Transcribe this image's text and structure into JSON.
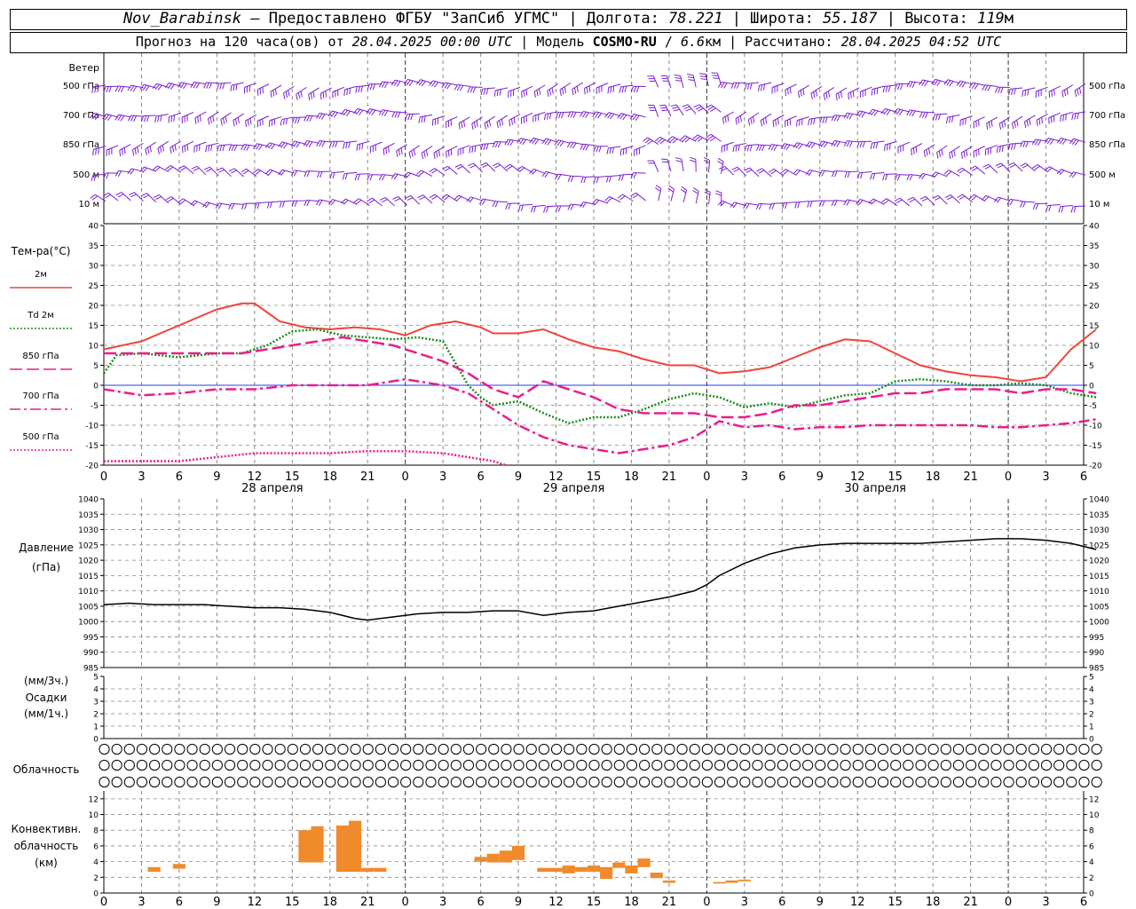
{
  "header": {
    "station": "Nov_Barabinsk",
    "provider": " — Предоставлено ФГБУ \"ЗапСиб УГМС\" | Долгота: ",
    "lon": "78.221",
    "lat_label": " | Широта: ",
    "lat": "55.187",
    "alt_label": " | Высота: ",
    "alt": "119",
    "alt_unit": "м",
    "forecast_label": "Прогноз на 120 часа(ов) от ",
    "forecast_from": "28.04.2025 00:00 UTC",
    "model_label": " | Модель ",
    "model": "COSMO-RU",
    "model_sep": " / ",
    "model_res": "6.6",
    "model_unit": "км",
    "calc_label": " | Рассчитано: ",
    "calc_time": "28.04.2025 04:52 UTC"
  },
  "time_axis": {
    "hour_labels": [
      "0",
      "3",
      "6",
      "9",
      "12",
      "15",
      "18",
      "21",
      "0",
      "3",
      "6",
      "9",
      "12",
      "15",
      "18",
      "21",
      "0",
      "3",
      "6",
      "9",
      "12",
      "15",
      "18",
      "21",
      "0",
      "3",
      "6"
    ],
    "day_labels": [
      {
        "label": "28 апреля",
        "hour": 12
      },
      {
        "label": "29 апреля",
        "hour": 36
      },
      {
        "label": "30 апреля",
        "hour": 60
      }
    ]
  },
  "wind_panel": {
    "title": "Ветер",
    "levels": [
      "500 гПа",
      "700 гПа",
      "850 гПа",
      "500  м",
      "10   м"
    ],
    "color": "#7a1fd1"
  },
  "chart_data": [
    {
      "type": "line",
      "name": "temperature",
      "title": "Тем-ра(°C)",
      "ylim": [
        -20,
        40
      ],
      "yticks": [
        -20,
        -15,
        -10,
        -5,
        0,
        5,
        10,
        15,
        20,
        25,
        30,
        35,
        40
      ],
      "grid": true,
      "legend_placement": "left",
      "series": [
        {
          "name": "2м",
          "color": "#f0443a",
          "style": "solid",
          "x": [
            0,
            3,
            6,
            9,
            11,
            12,
            14,
            16,
            18,
            20,
            22,
            24,
            26,
            28,
            30,
            31,
            33,
            35,
            37,
            39,
            41,
            43,
            45,
            47,
            49,
            51,
            53,
            55,
            57,
            59,
            61,
            63,
            65,
            67,
            69,
            71,
            73,
            75,
            77,
            79
          ],
          "y": [
            9,
            11,
            15,
            19,
            20.5,
            20.5,
            16,
            14.5,
            14,
            14.5,
            14,
            12.5,
            15,
            16,
            14.5,
            13,
            13,
            14,
            11.5,
            9.5,
            8.5,
            6.5,
            5,
            5,
            3,
            3.5,
            4.5,
            7,
            9.5,
            11.5,
            11,
            8,
            5,
            3.5,
            2.5,
            2,
            1,
            2,
            9,
            14
          ]
        },
        {
          "name": "Td 2м",
          "color": "#1e8a1e",
          "style": "dotted",
          "x": [
            0,
            1,
            3,
            6,
            9,
            11,
            13,
            15,
            17,
            19,
            21,
            23,
            25,
            27,
            29,
            30,
            31,
            33,
            35,
            37,
            39,
            41,
            43,
            45,
            47,
            49,
            51,
            53,
            55,
            57,
            59,
            61,
            63,
            65,
            67,
            69,
            71,
            73,
            75,
            77,
            79
          ],
          "y": [
            3,
            7.5,
            8,
            7,
            8,
            8,
            10,
            13.5,
            14,
            12.5,
            12,
            11.5,
            12,
            11,
            0,
            -3,
            -5,
            -4,
            -7,
            -9.5,
            -8,
            -8,
            -6,
            -3.5,
            -2,
            -3,
            -5.5,
            -4.5,
            -5.5,
            -4,
            -2.5,
            -2,
            1,
            1.5,
            1,
            0,
            0,
            0.5,
            0,
            -2,
            -3
          ]
        },
        {
          "name": "850 гПа",
          "color": "#e81e8c",
          "style": "dash",
          "x": [
            0,
            3,
            6,
            9,
            11,
            13,
            15,
            17,
            19,
            21,
            23,
            25,
            27,
            29,
            31,
            33,
            35,
            37,
            39,
            41,
            43,
            45,
            47,
            49,
            51,
            53,
            55,
            57,
            59,
            61,
            63,
            65,
            67,
            69,
            71,
            73,
            75,
            77,
            79
          ],
          "y": [
            8,
            8,
            8,
            8,
            8,
            9,
            10,
            11,
            12,
            11,
            10,
            8,
            6,
            3,
            -1,
            -3,
            1,
            -1,
            -3,
            -6,
            -7,
            -7,
            -7,
            -8,
            -8,
            -7,
            -5,
            -5,
            -4,
            -3,
            -2,
            -2,
            -1,
            -1,
            -1,
            -2,
            -1,
            -1,
            -2
          ]
        },
        {
          "name": "700 гПа",
          "color": "#e81e8c",
          "style": "dashdot",
          "x": [
            0,
            3,
            6,
            9,
            12,
            15,
            18,
            21,
            24,
            27,
            29,
            31,
            33,
            35,
            37,
            39,
            41,
            43,
            45,
            47,
            49,
            51,
            53,
            55,
            57,
            59,
            61,
            63,
            65,
            67,
            69,
            71,
            73,
            75,
            77,
            79
          ],
          "y": [
            -1,
            -2.5,
            -2,
            -1,
            -1,
            0,
            0,
            0,
            1.5,
            0,
            -2,
            -6,
            -10,
            -13,
            -15,
            -16,
            -17,
            -16,
            -15,
            -13,
            -9,
            -10.5,
            -10,
            -11,
            -10.5,
            -10.5,
            -10,
            -10,
            -10,
            -10,
            -10,
            -10.5,
            -10.5,
            -10,
            -9.5,
            -8.5
          ]
        },
        {
          "name": "500 гПа",
          "color": "#e81e8c",
          "style": "dotted",
          "x": [
            0,
            3,
            6,
            9,
            12,
            15,
            18,
            21,
            24,
            27,
            29,
            31,
            32
          ],
          "y": [
            -19,
            -19,
            -19,
            -18,
            -17,
            -17,
            -17,
            -16.5,
            -16.5,
            -17,
            -18,
            -19,
            -20
          ]
        }
      ]
    },
    {
      "type": "line",
      "name": "pressure",
      "title": "Давление",
      "ylabel": "(гПа)",
      "ylim": [
        985,
        1040
      ],
      "yticks": [
        985,
        990,
        995,
        1000,
        1005,
        1010,
        1015,
        1020,
        1025,
        1030,
        1035,
        1040
      ],
      "grid": true,
      "series": [
        {
          "color": "#000000",
          "x": [
            0,
            2,
            4,
            6,
            8,
            10,
            12,
            14,
            16,
            18,
            20,
            21,
            23,
            25,
            27,
            29,
            31,
            33,
            35,
            37,
            39,
            41,
            43,
            45,
            47,
            48,
            49,
            51,
            53,
            55,
            57,
            59,
            61,
            63,
            65,
            67,
            69,
            71,
            73,
            75,
            77,
            79
          ],
          "y": [
            1005.5,
            1006,
            1005.5,
            1005.5,
            1005.5,
            1005,
            1004.5,
            1004.5,
            1004,
            1003,
            1001,
            1000.5,
            1001.5,
            1002.5,
            1003,
            1003,
            1003.5,
            1003.5,
            1002,
            1003,
            1003.5,
            1005,
            1006.5,
            1008,
            1010,
            1012,
            1015,
            1019,
            1022,
            1024,
            1025,
            1025.5,
            1025.5,
            1025.5,
            1025.5,
            1026,
            1026.5,
            1027,
            1027,
            1026.5,
            1025.5,
            1023.5
          ]
        }
      ]
    },
    {
      "type": "bar",
      "name": "precipitation",
      "title": "Осадки",
      "ylabel_top": "(мм/3ч.)",
      "ylabel_bottom": "(мм/1ч.)",
      "ylim": [
        0,
        5
      ],
      "yticks": [
        0,
        1,
        2,
        3,
        4,
        5
      ],
      "values": []
    },
    {
      "type": "table",
      "name": "cloudiness",
      "title": "Облачность",
      "levels": [
        "high",
        "middle",
        "low"
      ],
      "interval_hours": 1,
      "rows": [
        [
          0,
          0,
          0,
          0,
          0,
          0,
          0,
          0,
          0,
          0,
          0,
          0,
          0,
          0,
          0,
          0,
          0,
          0,
          0,
          0,
          0,
          0,
          0,
          0,
          0,
          0,
          0,
          0,
          0,
          0,
          0,
          0,
          0,
          0,
          0,
          0,
          0,
          0,
          0,
          0,
          0,
          0,
          0,
          0,
          0,
          0,
          0,
          0,
          0,
          0,
          0,
          0,
          0,
          0,
          0,
          0,
          0,
          0,
          0,
          0,
          0,
          0,
          0,
          0,
          0,
          0,
          0,
          0,
          0,
          0,
          0,
          0,
          0,
          0,
          0,
          0,
          0,
          0,
          0,
          0
        ],
        [
          0,
          0,
          0,
          0,
          0,
          0,
          0,
          0,
          0,
          0,
          0,
          0,
          0,
          0,
          0,
          0,
          0,
          0,
          0,
          0,
          0,
          0,
          0,
          0,
          0,
          0,
          0,
          0,
          0,
          0,
          0,
          0,
          0,
          0,
          0,
          0,
          0,
          0,
          0,
          0,
          0,
          0,
          0,
          0,
          0,
          0,
          0,
          0,
          0,
          0,
          0,
          0,
          0,
          0,
          0,
          0,
          0,
          0,
          0,
          0,
          0,
          0,
          0,
          0,
          0,
          0,
          0,
          0,
          0,
          0,
          0,
          0,
          0,
          0,
          0,
          0,
          0,
          0,
          0,
          0
        ],
        [
          0,
          0,
          0,
          0,
          0,
          0,
          0,
          0,
          0,
          0,
          0,
          0,
          0,
          0,
          0,
          0,
          0,
          0,
          0,
          0,
          0,
          0,
          0,
          0,
          0,
          0,
          0,
          0,
          0,
          0,
          0,
          0,
          0,
          0,
          0,
          0,
          0,
          0,
          0,
          0,
          0,
          0,
          0,
          0,
          0,
          0,
          0,
          0,
          0,
          0,
          0,
          0,
          0,
          0,
          0,
          0,
          0,
          0,
          0,
          0,
          0,
          0,
          0,
          0,
          0,
          0,
          0,
          0,
          0,
          0,
          0,
          0,
          0,
          0,
          0,
          0,
          0,
          0,
          0,
          0
        ]
      ]
    },
    {
      "type": "bar",
      "name": "convective",
      "title_lines": [
        "Конвективн.",
        "облачность",
        "(км)"
      ],
      "ylim": [
        0,
        13
      ],
      "yticks": [
        0,
        2,
        4,
        6,
        8,
        10,
        12
      ],
      "color": "#f08a2a",
      "bars": [
        {
          "x": 4,
          "bottom": 2.7,
          "top": 3.3
        },
        {
          "x": 6,
          "bottom": 3.1,
          "top": 3.7
        },
        {
          "x": 16,
          "bottom": 3.9,
          "top": 8.0
        },
        {
          "x": 17,
          "bottom": 3.9,
          "top": 8.5
        },
        {
          "x": 19,
          "bottom": 2.7,
          "top": 8.6
        },
        {
          "x": 20,
          "bottom": 2.7,
          "top": 9.2
        },
        {
          "x": 21,
          "bottom": 2.7,
          "top": 3.2
        },
        {
          "x": 22,
          "bottom": 2.7,
          "top": 3.2
        },
        {
          "x": 30,
          "bottom": 4.0,
          "top": 4.6
        },
        {
          "x": 31,
          "bottom": 3.9,
          "top": 5.0
        },
        {
          "x": 32,
          "bottom": 3.9,
          "top": 5.4
        },
        {
          "x": 33,
          "bottom": 4.2,
          "top": 6.0
        },
        {
          "x": 35,
          "bottom": 2.7,
          "top": 3.2
        },
        {
          "x": 36,
          "bottom": 2.7,
          "top": 3.2
        },
        {
          "x": 37,
          "bottom": 2.5,
          "top": 3.5
        },
        {
          "x": 38,
          "bottom": 2.7,
          "top": 3.3
        },
        {
          "x": 39,
          "bottom": 2.7,
          "top": 3.5
        },
        {
          "x": 40,
          "bottom": 1.8,
          "top": 3.3
        },
        {
          "x": 41,
          "bottom": 3.2,
          "top": 3.9
        },
        {
          "x": 42,
          "bottom": 2.5,
          "top": 3.5
        },
        {
          "x": 43,
          "bottom": 3.3,
          "top": 4.4
        },
        {
          "x": 44,
          "bottom": 1.9,
          "top": 2.6
        },
        {
          "x": 45,
          "bottom": 1.3,
          "top": 1.6
        },
        {
          "x": 49,
          "bottom": 1.2,
          "top": 1.4
        },
        {
          "x": 50,
          "bottom": 1.3,
          "top": 1.6
        },
        {
          "x": 51,
          "bottom": 1.5,
          "top": 1.7
        }
      ]
    }
  ],
  "colors": {
    "grid": "#888888",
    "frame": "#000000",
    "zero_line": "#1e3cff"
  }
}
